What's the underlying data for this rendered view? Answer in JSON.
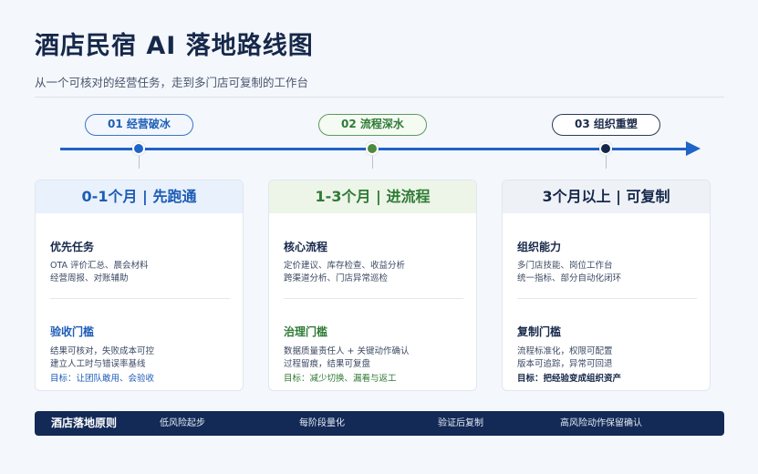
{
  "header": {
    "title": "酒店民宿 AI 落地路线图",
    "subtitle": "从一个可核对的经营任务，走到多门店可复制的工作台"
  },
  "timeline": {
    "stages": [
      {
        "label": "01 经营破冰",
        "color": "#1f64c8"
      },
      {
        "label": "02 流程深水",
        "color": "#4e8a3e"
      },
      {
        "label": "03 组织重塑",
        "color": "#14264a"
      }
    ]
  },
  "cards": [
    {
      "title": "0-1个月 | 先跑通",
      "section1_title": "优先任务",
      "section1_lines": [
        "OTA 评价汇总、晨会材料",
        "经营周报、对账辅助"
      ],
      "section2_title": "验收门槛",
      "section2_lines": [
        "结果可核对，失败成本可控",
        "建立人工时与错误率基线"
      ],
      "goal": "目标：让团队敢用、会验收"
    },
    {
      "title": "1-3个月 | 进流程",
      "section1_title": "核心流程",
      "section1_lines": [
        "定价建议、库存检查、收益分析",
        "跨渠道分析、门店异常巡检"
      ],
      "section2_title": "治理门槛",
      "section2_lines": [
        "数据质量责任人 + 关键动作确认",
        "过程留痕，结果可复盘"
      ],
      "goal": "目标：减少切换、漏看与返工"
    },
    {
      "title": "3个月以上 | 可复制",
      "section1_title": "组织能力",
      "section1_lines": [
        "多门店技能、岗位工作台",
        "统一指标、部分自动化闭环"
      ],
      "section2_title": "复制门槛",
      "section2_lines": [
        "流程标准化，权限可配置",
        "版本可追踪，异常可回退"
      ],
      "goal": "目标：把经验变成组织资产"
    }
  ],
  "footer": {
    "title": "酒店落地原则",
    "items": [
      "低风险起步",
      "每阶段量化",
      "验证后复制",
      "高风险动作保留确认"
    ]
  },
  "colors": {
    "accent_blue": "#1f64c8",
    "accent_green": "#4e8a3e",
    "accent_navy": "#14264a",
    "footer_bg": "#132a57"
  }
}
